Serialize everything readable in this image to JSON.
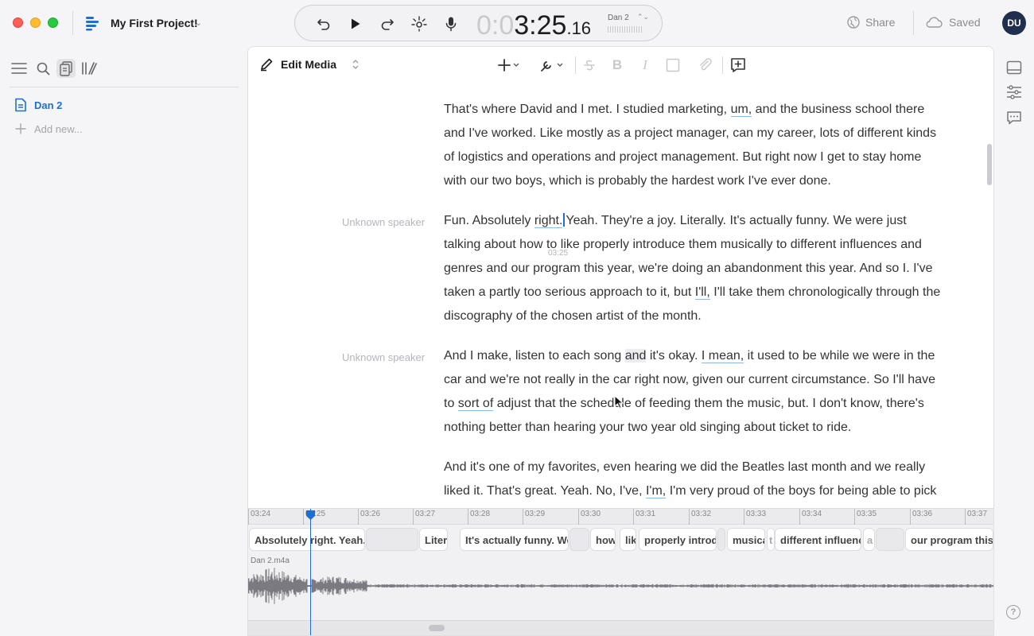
{
  "window": {
    "project_title": "My First Project!",
    "project_chevron_icon": "chevron-down-icon"
  },
  "transport": {
    "timecode_dim": "0:0",
    "timecode_main": "3:25",
    "timecode_frac": ".16",
    "track_name": "Dan 2",
    "track_arrows": "⌃⌄"
  },
  "header": {
    "share_label": "Share",
    "saved_label": "Saved",
    "avatar_initials": "DU"
  },
  "sidebar": {
    "document": "Dan 2",
    "add_new": "Add new..."
  },
  "toolbar": {
    "edit_mode_label": "Edit Media"
  },
  "transcript": {
    "caret_time": "03:25",
    "paragraphs": [
      {
        "speaker": "",
        "text": "That's where David and I met. I studied marketing, um, and the business school there and I've worked. Like mostly as a project manager, can my career, lots of different kinds of logistics and operations and project management. But right now I get to stay home with our two boys, which is probably the hardest work I've ever done."
      },
      {
        "speaker": "Unknown speaker",
        "text": "Fun. Absolutely right. Yeah. They're a joy. Literally. It's actually funny. We were just talking about how to like properly introduce them musically to different influences and genres and our program this year, we're doing an abandonment this year. And so I. I've taken a partly too serious approach to it, but I'll, I'll take them chronologically through the discography of the chosen artist of the month."
      },
      {
        "speaker": "Unknown speaker",
        "text": "And I make, listen to each song and it's okay. I mean, it used to be while we were in the car and we're not really in the car right now, given our current circumstance. So I'll have to sort of adjust that the schedule of feeding them the music, but. I don't know, there's nothing better than hearing your two year old singing about ticket to ride."
      },
      {
        "speaker": "",
        "text": "And it's one of my favorites, even hearing we did the Beatles last month and we really liked it. That's great. Yeah. No, I've, I'm, I'm very proud of the boys for being able to pick up on so"
      }
    ]
  },
  "timeline": {
    "ticks": [
      "03:24",
      "03:25",
      "03:26",
      "03:27",
      "03:28",
      "03:29",
      "03:30",
      "03:31",
      "03:32",
      "03:33",
      "03:34",
      "03:35",
      "03:36",
      "03:37"
    ],
    "word_chips": [
      "Absolutely right. Yeah.",
      "",
      "Liter",
      "It's actually funny. We",
      "",
      "how",
      "lik",
      "properly introd",
      "",
      "musica",
      "t",
      "different influenc",
      "a",
      "",
      "our program this"
    ],
    "audio_label": "Dan 2.m4a"
  },
  "colors": {
    "accent": "#1d6fd1",
    "underline": "#8fb9e8",
    "avatar_bg": "#1f2f4d"
  }
}
